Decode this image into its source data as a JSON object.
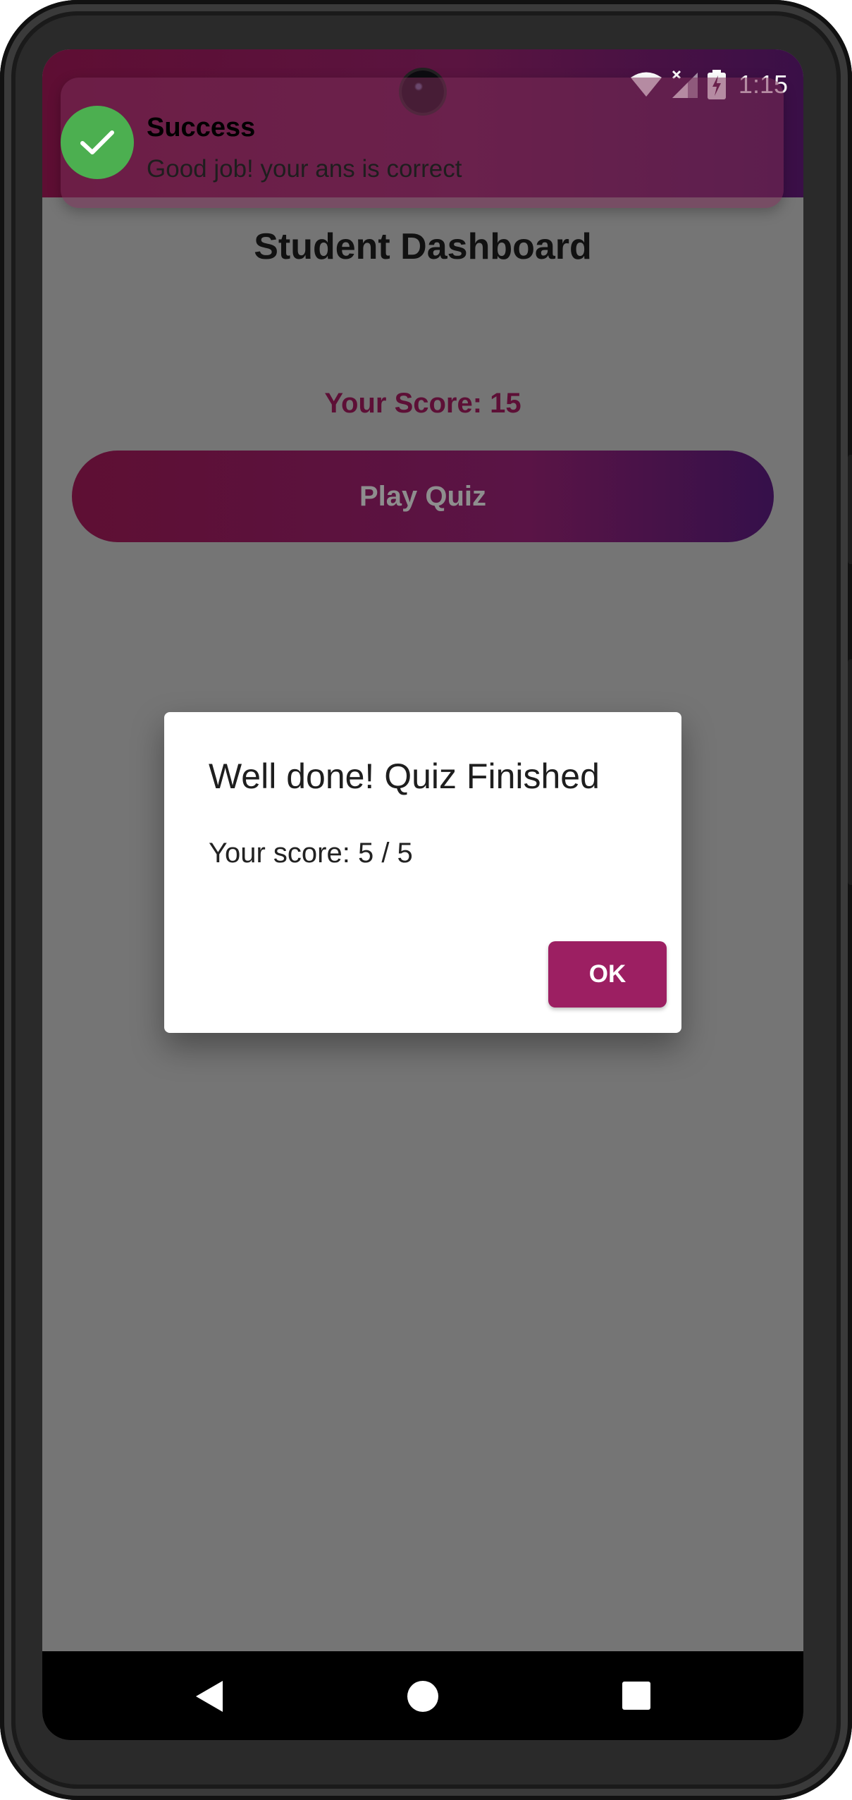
{
  "status_bar": {
    "time": "1:15",
    "icons": [
      "wifi-icon",
      "signal-icon",
      "battery-charging-icon"
    ]
  },
  "snackbar": {
    "icon": "check-icon",
    "title": "Success",
    "message": "Good job! your ans is correct"
  },
  "dashboard": {
    "title": "Student Dashboard",
    "score_text": "Your Score: 15",
    "play_button_label": "Play Quiz"
  },
  "dialog": {
    "title": "Well done! Quiz Finished",
    "body": "Your score: 5 / 5",
    "ok_label": "OK"
  },
  "nav_bar": {
    "icons": [
      "back-icon",
      "home-icon",
      "recents-icon"
    ]
  },
  "colors": {
    "header_gradient_start": "#5e0e33",
    "header_gradient_end": "#3a0f47",
    "accent": "#9c1f62",
    "score_text": "#5d0f36",
    "success_green": "#4caf50",
    "scrim": "#757575"
  }
}
